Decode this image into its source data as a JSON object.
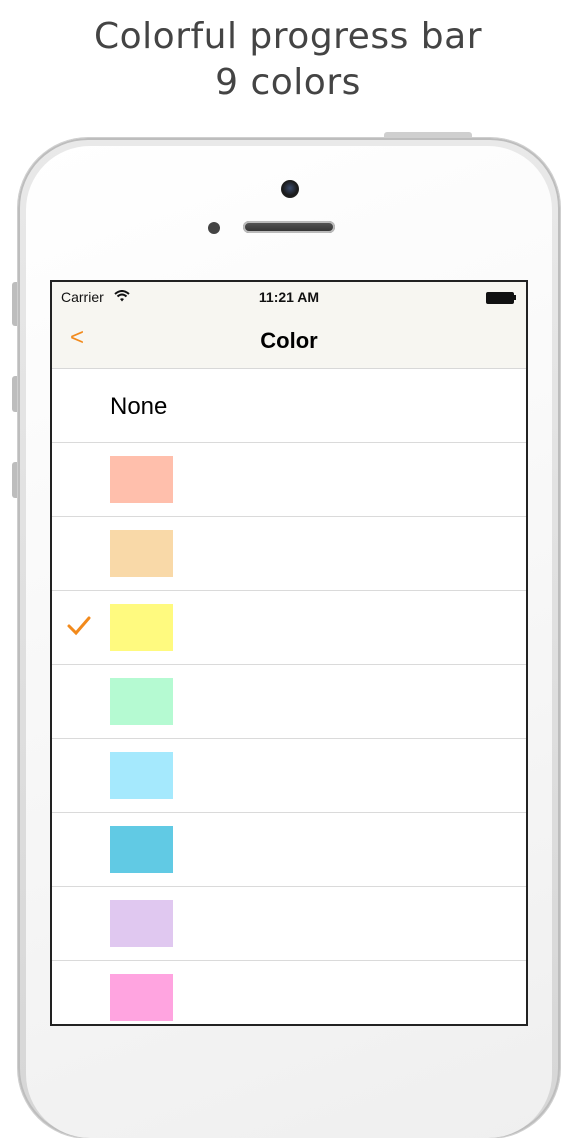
{
  "headline": {
    "line1": "Colorful progress bar",
    "line2": "9 colors"
  },
  "status_bar": {
    "carrier": "Carrier",
    "time": "11:21 AM",
    "wifi_icon": "wifi-icon",
    "battery_icon": "battery-icon"
  },
  "nav": {
    "back_label": "<",
    "title": "Color"
  },
  "options": {
    "none_label": "None",
    "selected_index": 3,
    "swatches": [
      "#ffbfac",
      "#f9d9a8",
      "#fffa7f",
      "#b5fad2",
      "#a5e9fd",
      "#61cae4",
      "#e0c8f0",
      "#ffa4e0"
    ]
  },
  "colors": {
    "accent": "#f28a1c"
  }
}
